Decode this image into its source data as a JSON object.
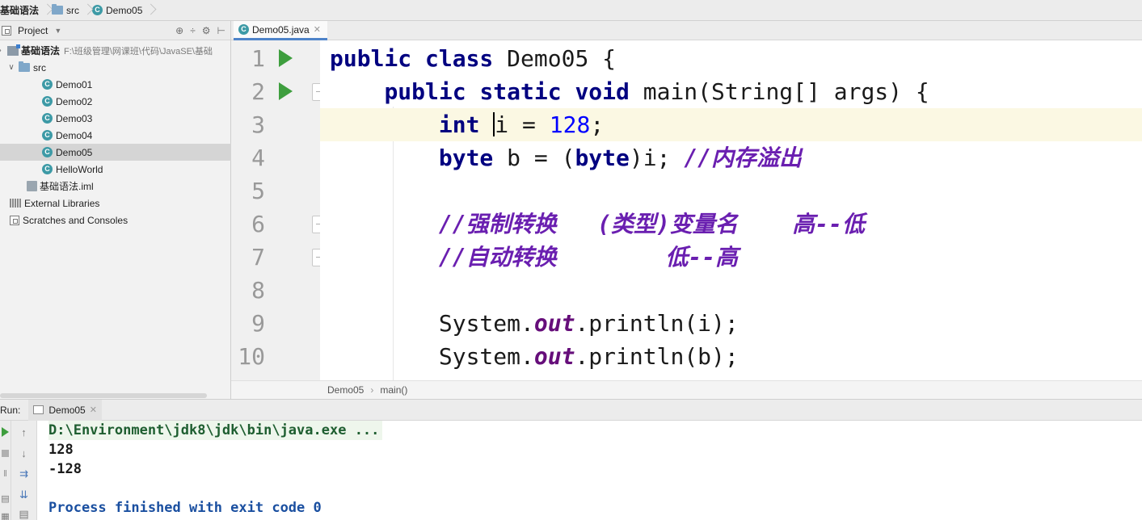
{
  "breadcrumb": {
    "project": "基础语法",
    "folder": "src",
    "file": "Demo05"
  },
  "project_panel": {
    "title": "Project",
    "tools": [
      "⊕",
      "÷",
      "⚙",
      "⊢"
    ],
    "root": {
      "name": "基础语法",
      "path": "F:\\班级管理\\网课班\\代码\\JavaSE\\基础"
    },
    "src": "src",
    "classes": [
      "Demo01",
      "Demo02",
      "Demo03",
      "Demo04",
      "Demo05",
      "HelloWorld"
    ],
    "iml": "基础语法.iml",
    "external_libraries": "External Libraries",
    "scratches": "Scratches and Consoles"
  },
  "editor": {
    "tab_label": "Demo05.java",
    "lines": [
      "1",
      "2",
      "3",
      "4",
      "5",
      "6",
      "7",
      "8",
      "9",
      "10"
    ],
    "breadcrumb_class": "Demo05",
    "breadcrumb_method": "main()"
  },
  "code": {
    "l1": {
      "kw": "public class",
      "rest": " Demo05 {"
    },
    "l2": {
      "indent": "    ",
      "kw": "public static void",
      "rest": " main(String[] args) {"
    },
    "l3": {
      "indent": "        ",
      "kw": "int",
      "pre": " ",
      "var": "i",
      "mid": " = ",
      "num": "128",
      "end": ";"
    },
    "l4": {
      "indent": "        ",
      "kw1": "byte",
      "mid": " b = (",
      "kw2": "byte",
      "rest": ")i; ",
      "comment": "//内存溢出"
    },
    "l6": {
      "indent": "        ",
      "comment": "//强制转换   (类型)变量名    高--低"
    },
    "l7": {
      "indent": "        ",
      "comment": "//自动转换        低--高"
    },
    "l9": {
      "indent": "        ",
      "pre": "System.",
      "field": "out",
      "rest": ".println(i);"
    },
    "l10": {
      "indent": "        ",
      "pre": "System.",
      "field": "out",
      "rest": ".println(b);"
    }
  },
  "run": {
    "label": "Run:",
    "tab": "Demo05",
    "console": {
      "cmd": "D:\\Environment\\jdk8\\jdk\\bin\\java.exe ...",
      "out1": "128",
      "out2": "-128",
      "finish": "Process finished with exit code 0"
    }
  }
}
